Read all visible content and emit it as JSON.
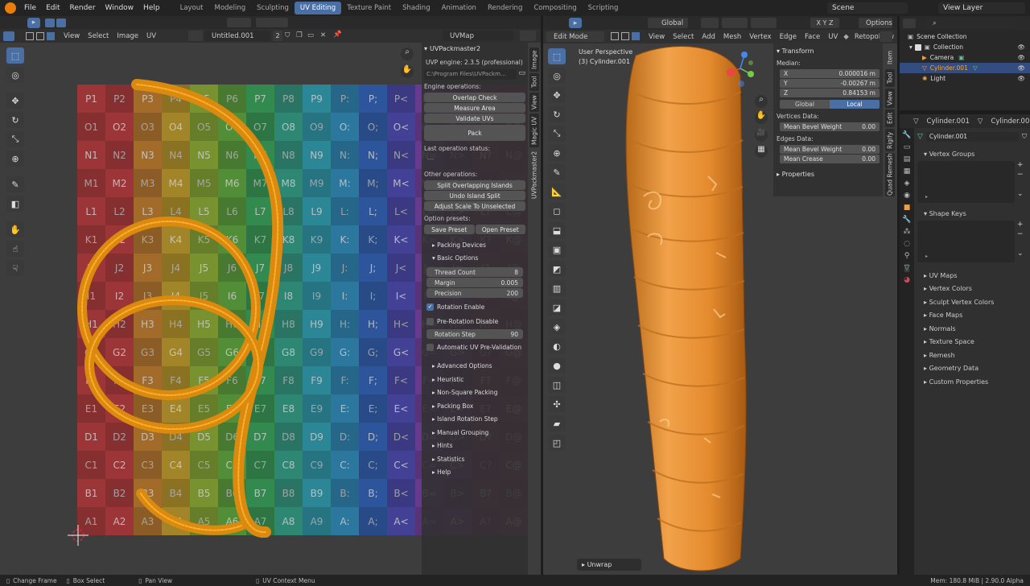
{
  "topbar": {
    "menus": [
      "File",
      "Edit",
      "Render",
      "Window",
      "Help"
    ],
    "workspaces": [
      "Layout",
      "Modeling",
      "Sculpting",
      "UV Editing",
      "Texture Paint",
      "Shading",
      "Animation",
      "Rendering",
      "Compositing",
      "Scripting"
    ],
    "active_workspace": "UV Editing",
    "scene": "Scene",
    "view_layer": "View Layer"
  },
  "uv_editor": {
    "menus": [
      "View",
      "Select",
      "Image",
      "UV"
    ],
    "image_name": "Untitled.001",
    "users": "2",
    "uvmap": "UVMap",
    "grid_rows": [
      "P",
      "O",
      "N",
      "M",
      "L",
      "K",
      "J",
      "I",
      "H",
      "G",
      "F",
      "E",
      "D",
      "C",
      "B",
      "A"
    ],
    "grid_cols": [
      "1",
      "2",
      "3",
      "4",
      "5",
      "6",
      "7",
      "8",
      "9",
      ":",
      ";",
      "<",
      "=",
      ">",
      "?",
      "@"
    ],
    "col_colors": [
      "#c0393b",
      "#c0393b",
      "#c9802a",
      "#c9a227",
      "#8fb330",
      "#5fae3b",
      "#36a85a",
      "#2fa58a",
      "#2ba3b8",
      "#2b8fc4",
      "#2e63c0",
      "#4a49b8",
      "#7a3fae",
      "#8f3a9c",
      "#963a7a",
      "#9a3a66"
    ]
  },
  "npanel": {
    "title": "UVPackmaster2",
    "engine": "UVP engine: 2.3.5 (professional)",
    "path": "C:\\Program Files\\UVPackm...",
    "engine_ops_label": "Engine operations:",
    "engine_ops": [
      "Overlap Check",
      "Measure Area",
      "Validate UVs"
    ],
    "pack": "Pack",
    "last_status_label": "Last operation status:",
    "last_status": "---",
    "other_ops_label": "Other operations:",
    "other_ops": [
      "Split Overlapping Islands",
      "Undo Island Split",
      "Adjust Scale To Unselected"
    ],
    "presets_label": "Option presets:",
    "save_preset": "Save Preset",
    "open_preset": "Open Preset",
    "packing_devices": "Packing Devices",
    "basic_options": "Basic Options",
    "thread_count_label": "Thread Count",
    "thread_count": "8",
    "margin_label": "Margin",
    "margin": "0.005",
    "precision_label": "Precision",
    "precision": "200",
    "rotation_enable": "Rotation Enable",
    "pre_rotation_disable": "Pre-Rotation Disable",
    "rotation_step_label": "Rotation Step",
    "rotation_step": "90",
    "auto_uv_prevalidation": "Automatic UV Pre-Validation",
    "sections": [
      "Advanced Options",
      "Heuristic",
      "Non-Square Packing",
      "Packing Box",
      "Island Rotation Step",
      "Manual Grouping",
      "Hints",
      "Statistics",
      "Help"
    ],
    "tabs": [
      "Image",
      "Tool",
      "View",
      "Magic UV",
      "UVPackmaster2"
    ]
  },
  "viewport": {
    "mode": "Edit Mode",
    "menus": [
      "View",
      "Select",
      "Add",
      "Mesh",
      "Vertex",
      "Edge",
      "Face",
      "UV"
    ],
    "orientation": "Global",
    "addon": "RetopoFlow",
    "options": "Options",
    "persp": "User Perspective",
    "object": "(3) Cylinder.001",
    "unwrap": "Unwrap",
    "tabs": [
      "Item",
      "Tool",
      "View",
      "Edit",
      "Rigify",
      "Quad Remesh"
    ]
  },
  "transform": {
    "title": "Transform",
    "median_label": "Median:",
    "x_label": "X",
    "x": "0.000016 m",
    "y_label": "Y",
    "y": "-0.00267 m",
    "z_label": "Z",
    "z": "0.84153 m",
    "global": "Global",
    "local": "Local",
    "vertices_data": "Vertices Data:",
    "mean_bevel_weight_label": "Mean Bevel Weight",
    "v_bevel": "0.00",
    "edges_data": "Edges Data:",
    "e_bevel": "0.00",
    "mean_crease_label": "Mean Crease",
    "crease": "0.00",
    "properties": "Properties"
  },
  "outliner": {
    "scene_collection": "Scene Collection",
    "collection": "Collection",
    "items": [
      "Camera",
      "Cylinder.001",
      "Light"
    ]
  },
  "properties": {
    "object_name": "Cylinder.001",
    "mesh_name": "Cylinder.001",
    "mesh_field": "Cylinder.001",
    "vertex_groups": "Vertex Groups",
    "shape_keys": "Shape Keys",
    "panels": [
      "UV Maps",
      "Vertex Colors",
      "Sculpt Vertex Colors",
      "Face Maps",
      "Normals",
      "Texture Space",
      "Remesh",
      "Geometry Data",
      "Custom Properties"
    ]
  },
  "statusbar": {
    "change_frame": "Change Frame",
    "box_select": "Box Select",
    "pan_view": "Pan View",
    "uv_context": "UV Context Menu",
    "stats": "Mem: 180.8 MiB | 2.90.0 Alpha"
  }
}
